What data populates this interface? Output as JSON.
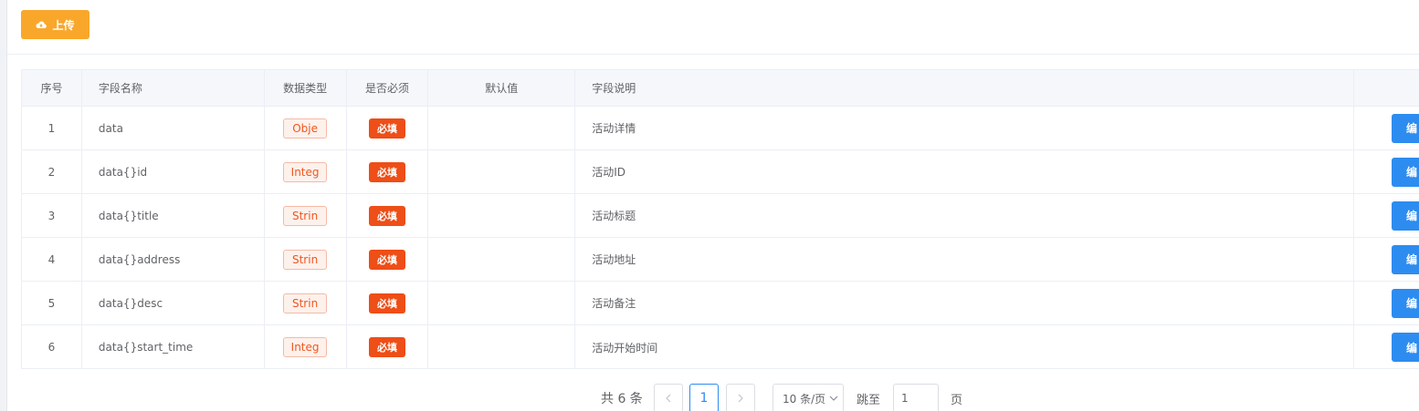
{
  "toolbar": {
    "upload_label": "上传",
    "upload_icon": "cloud-upload-icon",
    "upload_color": "#f9a72b"
  },
  "table": {
    "headers": {
      "index": "序号",
      "name": "字段名称",
      "type": "数据类型",
      "required": "是否必须",
      "default": "默认值",
      "desc": "字段说明"
    },
    "rows": [
      {
        "index": "1",
        "name": "data",
        "type": "Obje",
        "required": "必填",
        "default": "",
        "desc": "活动详情",
        "action": "编"
      },
      {
        "index": "2",
        "name": "data{}id",
        "type": "Integ",
        "required": "必填",
        "default": "",
        "desc": "活动ID",
        "action": "编"
      },
      {
        "index": "3",
        "name": "data{}title",
        "type": "Strin",
        "required": "必填",
        "default": "",
        "desc": "活动标题",
        "action": "编"
      },
      {
        "index": "4",
        "name": "data{}address",
        "type": "Strin",
        "required": "必填",
        "default": "",
        "desc": "活动地址",
        "action": "编"
      },
      {
        "index": "5",
        "name": "data{}desc",
        "type": "Strin",
        "required": "必填",
        "default": "",
        "desc": "活动备注",
        "action": "编"
      },
      {
        "index": "6",
        "name": "data{}start_time",
        "type": "Integ",
        "required": "必填",
        "default": "",
        "desc": "活动开始时间",
        "action": "编"
      }
    ]
  },
  "pagination": {
    "total_text": "共 6 条",
    "current_page": "1",
    "page_size_label": "10 条/页",
    "jump_label": "跳至",
    "jump_value": "1",
    "page_suffix": "页"
  },
  "colors": {
    "required_tag": "#ee4e17",
    "type_tag_text": "#f0561f",
    "edit_button": "#2d8cf0"
  }
}
